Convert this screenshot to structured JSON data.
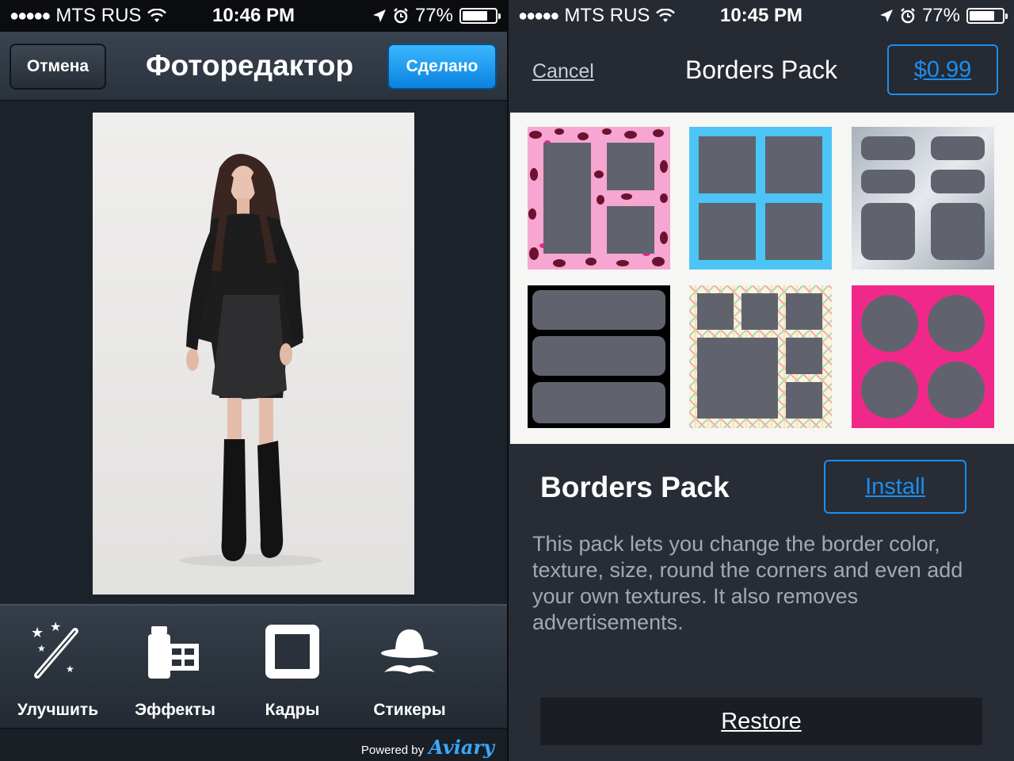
{
  "left_screen": {
    "status": {
      "carrier": "MTS RUS",
      "time": "10:46 PM",
      "battery": "77%"
    },
    "nav": {
      "cancel_label": "Отмена",
      "title": "Фоторедактор",
      "done_label": "Сделано"
    },
    "tools": [
      {
        "label": "Улучшить",
        "icon": "magic-wand-icon"
      },
      {
        "label": "Эффекты",
        "icon": "film-effects-icon"
      },
      {
        "label": "Кадры",
        "icon": "frame-icon"
      },
      {
        "label": "Стикеры",
        "icon": "hat-mustache-icon"
      }
    ],
    "footer": {
      "powered_by": "Powered by",
      "brand": "Aviary"
    }
  },
  "right_screen": {
    "status": {
      "carrier": "MTS RUS",
      "time": "10:45 PM",
      "battery": "77%"
    },
    "nav": {
      "cancel_label": "Cancel",
      "title": "Borders Pack",
      "price_label": "$0.99"
    },
    "pack_title": "Borders Pack",
    "install_label": "Install",
    "description": "This pack lets you change the border color, texture, size, round the corners and even add your own textures. It also removes advertisements.",
    "restore_label": "Restore",
    "colors": {
      "accent": "#1b8ef0",
      "done_button": "#1a9cf5",
      "pink": "#f0288a",
      "cyan": "#4cc4f5"
    }
  }
}
